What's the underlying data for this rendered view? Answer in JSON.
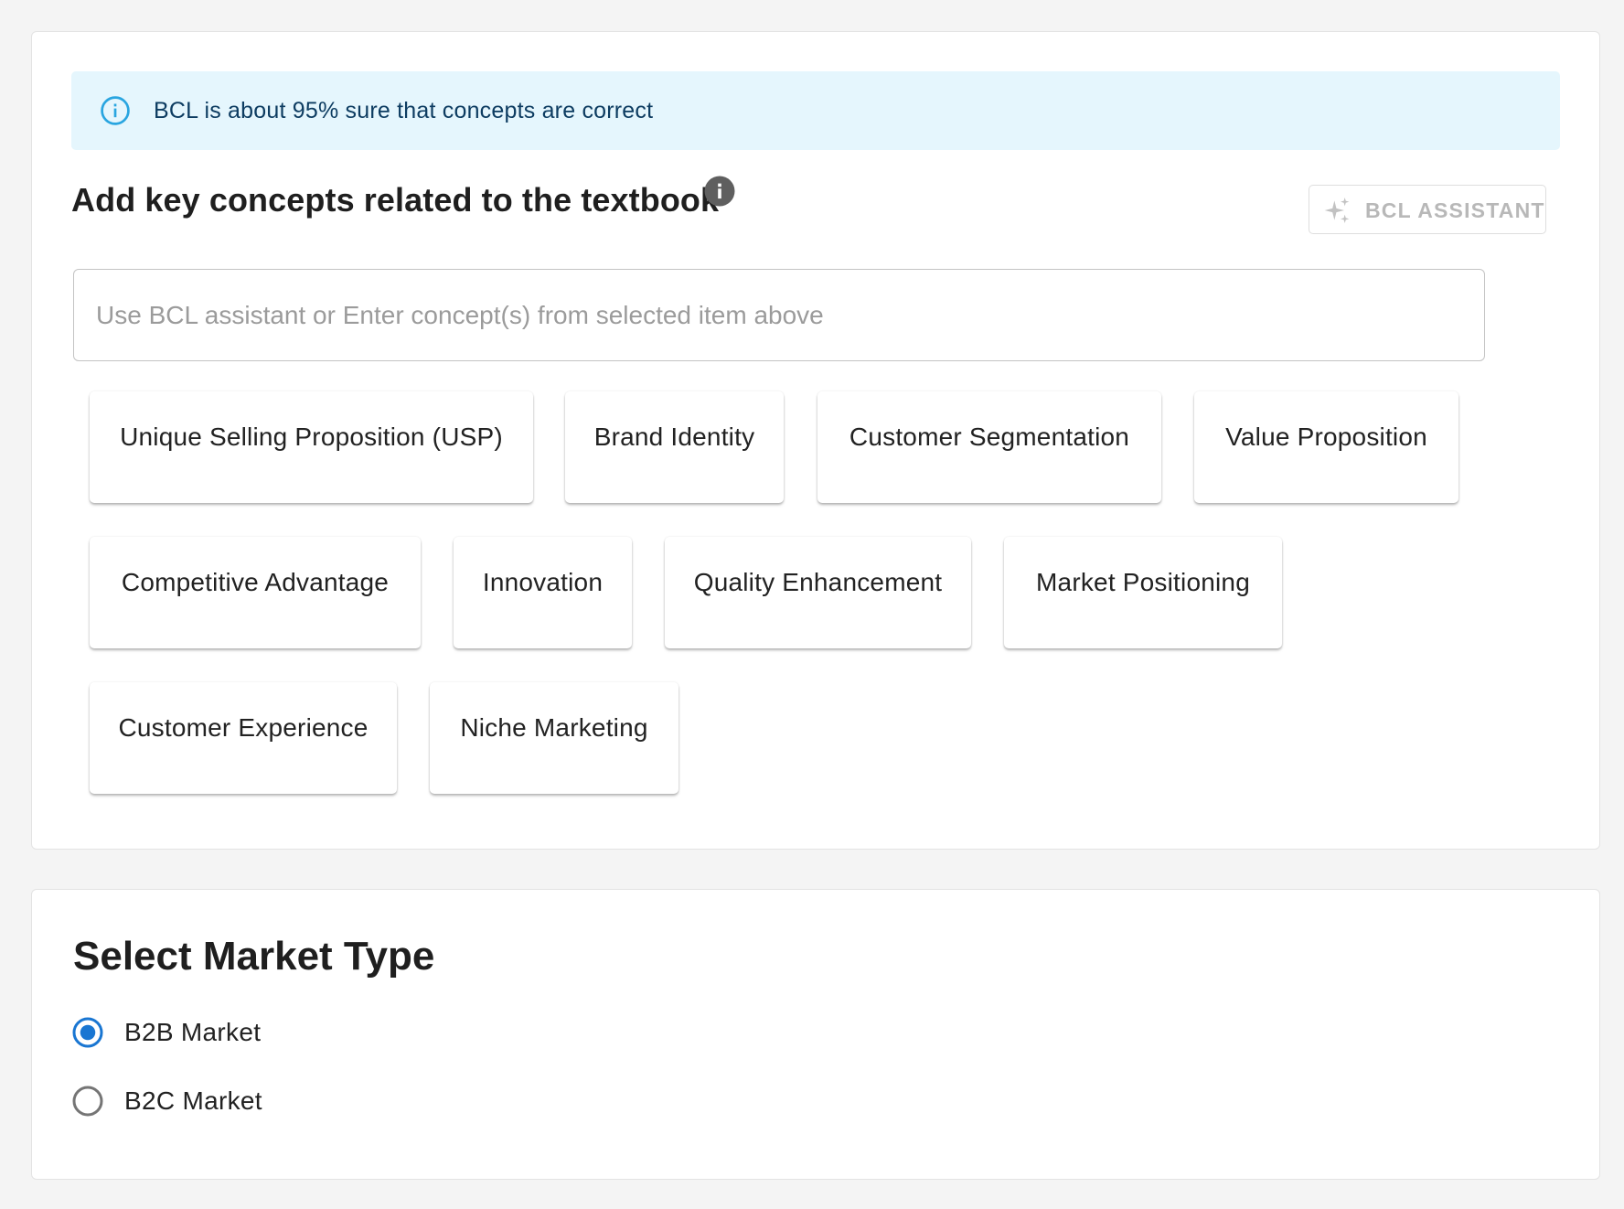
{
  "colors": {
    "accent": "#1976d2",
    "info_bg": "#e5f6fd",
    "info_icon": "#29a5e0",
    "info_text": "#0d3c61",
    "disabled_text": "#b8b8b8"
  },
  "alert": {
    "icon": "info-outline-icon",
    "text": "BCL is about 95% sure that concepts are correct"
  },
  "concepts_section": {
    "title": "Add key concepts related to the textbook",
    "title_icon": "info-filled-icon",
    "assistant_button": {
      "label": "BCL ASSISTANT",
      "icon": "sparkle-icon",
      "disabled": true
    },
    "input": {
      "value": "",
      "placeholder": "Use BCL assistant or Enter concept(s) from selected item above"
    },
    "concepts": [
      "Unique Selling Proposition (USP)",
      "Brand Identity",
      "Customer Segmentation",
      "Value Proposition",
      "Competitive Advantage",
      "Innovation",
      "Quality Enhancement",
      "Market Positioning",
      "Customer Experience",
      "Niche Marketing"
    ]
  },
  "market_section": {
    "title": "Select Market Type",
    "options": [
      {
        "label": "B2B Market",
        "selected": true
      },
      {
        "label": "B2C Market",
        "selected": false
      }
    ]
  }
}
